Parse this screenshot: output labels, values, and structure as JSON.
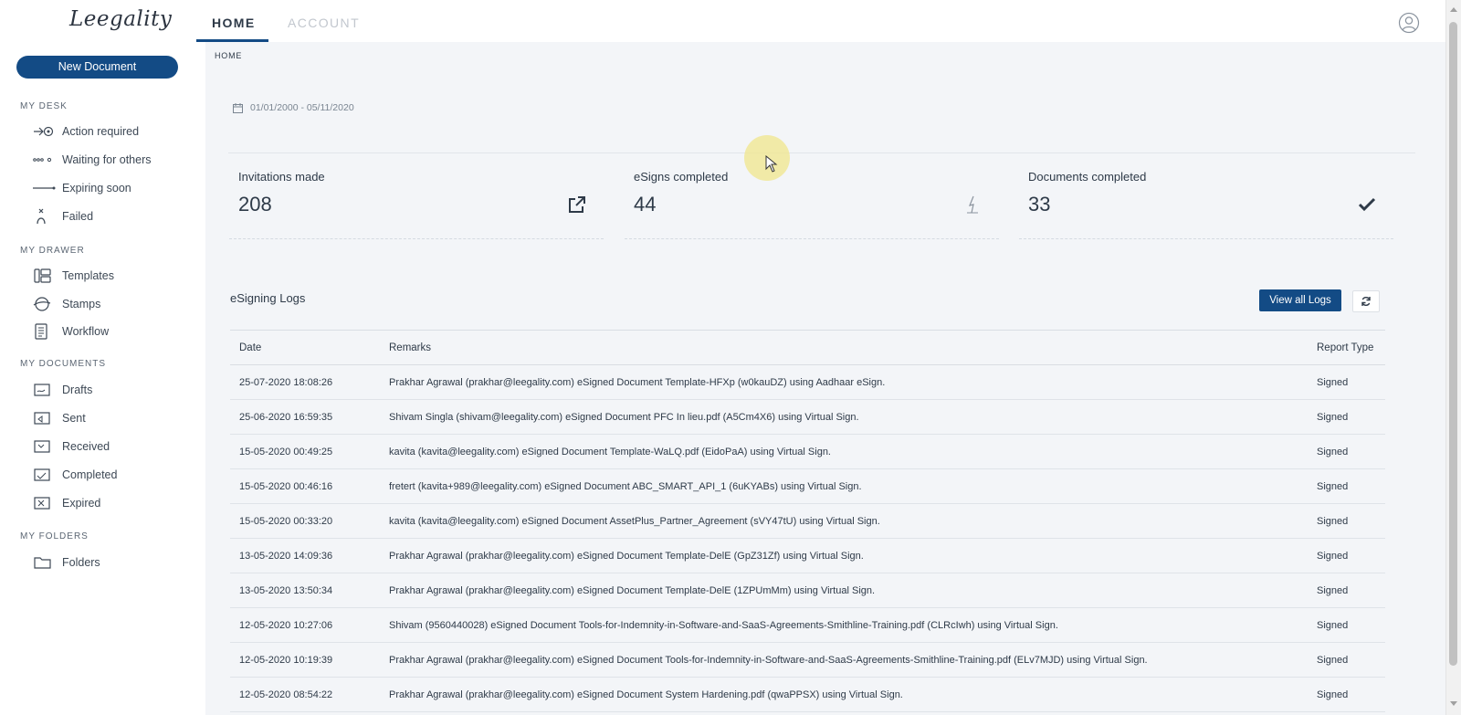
{
  "header": {
    "logo_text": "Leegality",
    "tabs": [
      {
        "label": "HOME",
        "active": true
      },
      {
        "label": "ACCOUNT",
        "active": false
      }
    ]
  },
  "sidebar": {
    "new_document_label": "New Document",
    "sections": [
      {
        "title": "MY DESK",
        "items": [
          {
            "label": "Action required",
            "icon": "action-required-icon"
          },
          {
            "label": "Waiting for others",
            "icon": "waiting-icon"
          },
          {
            "label": "Expiring soon",
            "icon": "expiring-icon"
          },
          {
            "label": "Failed",
            "icon": "failed-icon"
          }
        ]
      },
      {
        "title": "MY DRAWER",
        "items": [
          {
            "label": "Templates",
            "icon": "templates-icon"
          },
          {
            "label": "Stamps",
            "icon": "stamps-icon"
          },
          {
            "label": "Workflow",
            "icon": "workflow-icon"
          }
        ]
      },
      {
        "title": "MY DOCUMENTS",
        "items": [
          {
            "label": "Drafts",
            "icon": "drafts-icon"
          },
          {
            "label": "Sent",
            "icon": "sent-icon"
          },
          {
            "label": "Received",
            "icon": "received-icon"
          },
          {
            "label": "Completed",
            "icon": "completed-icon"
          },
          {
            "label": "Expired",
            "icon": "expired-icon"
          }
        ]
      },
      {
        "title": "MY FOLDERS",
        "items": [
          {
            "label": "Folders",
            "icon": "folder-icon"
          }
        ]
      }
    ]
  },
  "main": {
    "breadcrumb": "HOME",
    "date_range": "01/01/2000 - 05/11/2020",
    "stats": [
      {
        "label": "Invitations made",
        "value": "208",
        "icon": "external-link-icon"
      },
      {
        "label": "eSigns completed",
        "value": "44",
        "icon": "esign-pen-icon"
      },
      {
        "label": "Documents completed",
        "value": "33",
        "icon": "checkmark-icon"
      }
    ],
    "logs": {
      "title": "eSigning Logs",
      "view_all_label": "View all Logs",
      "columns": [
        "Date",
        "Remarks",
        "Report Type"
      ],
      "rows": [
        [
          "25-07-2020 18:08:26",
          "Prakhar Agrawal (prakhar@leegality.com) eSigned Document Template-HFXp (w0kauDZ) using Aadhaar eSign.",
          "Signed"
        ],
        [
          "25-06-2020 16:59:35",
          "Shivam Singla (shivam@leegality.com) eSigned Document PFC In lieu.pdf (A5Cm4X6) using Virtual Sign.",
          "Signed"
        ],
        [
          "15-05-2020 00:49:25",
          "kavita (kavita@leegality.com) eSigned Document Template-WaLQ.pdf (EidoPaA) using Virtual Sign.",
          "Signed"
        ],
        [
          "15-05-2020 00:46:16",
          "fretert (kavita+989@leegality.com) eSigned Document ABC_SMART_API_1 (6uKYABs) using Virtual Sign.",
          "Signed"
        ],
        [
          "15-05-2020 00:33:20",
          "kavita (kavita@leegality.com) eSigned Document AssetPlus_Partner_Agreement (sVY47tU) using Virtual Sign.",
          "Signed"
        ],
        [
          "13-05-2020 14:09:36",
          "Prakhar Agrawal (prakhar@leegality.com) eSigned Document Template-DelE (GpZ31Zf) using Virtual Sign.",
          "Signed"
        ],
        [
          "13-05-2020 13:50:34",
          "Prakhar Agrawal (prakhar@leegality.com) eSigned Document Template-DelE (1ZPUmMm) using Virtual Sign.",
          "Signed"
        ],
        [
          "12-05-2020 10:27:06",
          "Shivam (9560440028) eSigned Document Tools-for-Indemnity-in-Software-and-SaaS-Agreements-Smithline-Training.pdf (CLRcIwh) using Virtual Sign.",
          "Signed"
        ],
        [
          "12-05-2020 10:19:39",
          "Prakhar Agrawal (prakhar@leegality.com) eSigned Document Tools-for-Indemnity-in-Software-and-SaaS-Agreements-Smithline-Training.pdf (ELv7MJD) using Virtual Sign.",
          "Signed"
        ],
        [
          "12-05-2020 08:54:22",
          "Prakhar Agrawal (prakhar@leegality.com) eSigned Document System Hardening.pdf (qwaPPSX) using Virtual Sign.",
          "Signed"
        ]
      ]
    }
  },
  "colors": {
    "primary": "#134b85",
    "background": "#f3f5f8",
    "text": "#2e3a48"
  }
}
